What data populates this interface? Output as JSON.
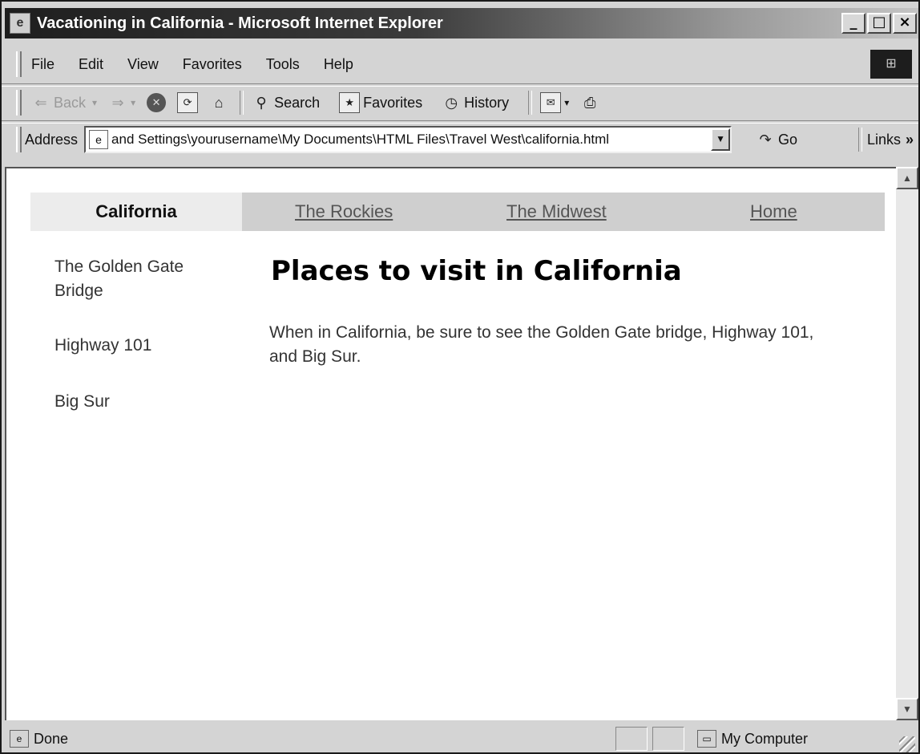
{
  "window": {
    "title": "Vacationing in California - Microsoft Internet Explorer",
    "controls": {
      "minimize": "_",
      "maximize": "□",
      "close": "×"
    }
  },
  "menu": [
    "File",
    "Edit",
    "View",
    "Favorites",
    "Tools",
    "Help"
  ],
  "toolbar": {
    "back": "Back",
    "search": "Search",
    "favorites": "Favorites",
    "history": "History"
  },
  "address": {
    "label": "Address",
    "value": "and Settings\\yourusername\\My Documents\\HTML Files\\Travel West\\california.html",
    "go": "Go",
    "links": "Links",
    "links_chevron": "»"
  },
  "page": {
    "nav": {
      "current": "California",
      "links": [
        "The Rockies",
        "The Midwest",
        "Home"
      ]
    },
    "sidebar": [
      "The Golden Gate Bridge",
      "Highway 101",
      "Big Sur"
    ],
    "heading": "Places to visit in California",
    "body": "When in California, be sure to see the Golden Gate bridge, Highway 101, and Big Sur."
  },
  "status": {
    "text": "Done",
    "zone": "My Computer"
  }
}
